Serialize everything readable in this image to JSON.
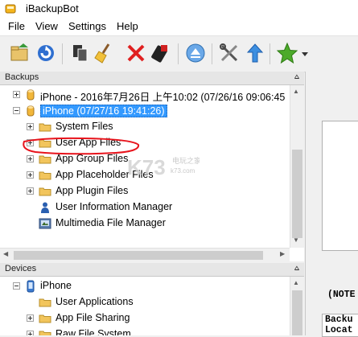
{
  "window": {
    "title": "iBackupBot"
  },
  "menu": [
    "File",
    "View",
    "Settings",
    "Help"
  ],
  "toolbar": {
    "buttons": [
      {
        "name": "open-folder-icon"
      },
      {
        "name": "refresh-icon"
      },
      {
        "name": "copy-icon"
      },
      {
        "name": "broom-icon"
      },
      {
        "name": "delete-icon"
      },
      {
        "name": "device-icon"
      },
      {
        "name": "eject-icon"
      },
      {
        "name": "tools-icon"
      },
      {
        "name": "upload-arrow-icon"
      },
      {
        "name": "star-icon"
      },
      {
        "name": "dropdown-icon"
      }
    ]
  },
  "backups_pane": {
    "header": "Backups",
    "pin": "⩟",
    "items": [
      {
        "label": "iPhone - 2016年7月26日 上午10:02 (07/26/16 09:06:45",
        "expander": "plus",
        "icon": "device-cylinder-icon"
      },
      {
        "label": "iPhone (07/27/16 19:41:26)",
        "expander": "minus",
        "icon": "device-cylinder-icon",
        "selected": true
      },
      {
        "label": "System Files",
        "expander": "plus",
        "icon": "folder-icon"
      },
      {
        "label": "User App Files",
        "expander": "plus",
        "icon": "folder-icon"
      },
      {
        "label": "App Group Files",
        "expander": "plus",
        "icon": "folder-icon"
      },
      {
        "label": "App Placeholder Files",
        "expander": "plus",
        "icon": "folder-icon"
      },
      {
        "label": "App Plugin Files",
        "expander": "plus",
        "icon": "folder-icon"
      },
      {
        "label": "User Information Manager",
        "expander": "none",
        "icon": "user-icon"
      },
      {
        "label": "Multimedia File Manager",
        "expander": "none",
        "icon": "multimedia-icon"
      }
    ]
  },
  "devices_pane": {
    "header": "Devices",
    "pin": "⩟",
    "items": [
      {
        "label": "iPhone",
        "expander": "minus",
        "icon": "phone-icon"
      },
      {
        "label": "User Applications",
        "expander": "none",
        "icon": "folder-icon"
      },
      {
        "label": "App File Sharing",
        "expander": "plus",
        "icon": "folder-icon"
      },
      {
        "label": "Raw File System",
        "expander": "plus",
        "icon": "folder-icon"
      }
    ]
  },
  "right_panel": {
    "note": "(NOTE",
    "line1": "Backu",
    "line2": "Locat"
  },
  "watermark": {
    "text": "K73",
    "sub1": "电玩之家",
    "sub2": "k73.com"
  },
  "colors": {
    "selection": "#3399ff",
    "annotation": "#e8141c",
    "folder": "#f2c55c"
  }
}
